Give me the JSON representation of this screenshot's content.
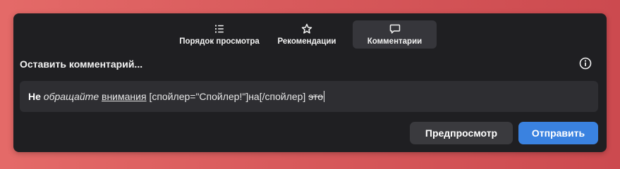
{
  "tabs": [
    {
      "label": "Порядок просмотра",
      "icon": "list-icon"
    },
    {
      "label": "Рекомендации",
      "icon": "star-icon"
    },
    {
      "label": "Комментарии",
      "icon": "comment-icon",
      "active": true
    }
  ],
  "comment_form": {
    "heading": "Оставить комментарий...",
    "info_icon": "info-icon",
    "input": {
      "bold": "Не",
      "space1": " ",
      "italic": "обращайте",
      "space2": " ",
      "underline": "внимания",
      "plain": " [спойлер=\"Спойлер!\"]на[/спойлер] ",
      "strike": "это"
    },
    "preview_label": "Предпросмотр",
    "send_label": "Отправить"
  },
  "colors": {
    "panel_bg": "#1f1f22",
    "input_bg": "#2e2e32",
    "active_tab_bg": "#36363b",
    "send_button": "#3a82e0",
    "preview_button": "#3a3a3e"
  }
}
